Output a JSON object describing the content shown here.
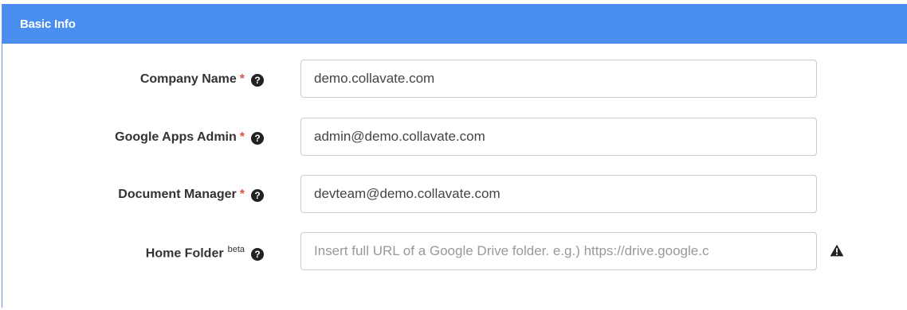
{
  "panel": {
    "title": "Basic Info",
    "header_color": "#4a8ff0"
  },
  "fields": {
    "company_name": {
      "label": "Company Name",
      "required_mark": "*",
      "value": "demo.collavate.com"
    },
    "google_apps_admin": {
      "label": "Google Apps Admin",
      "required_mark": "*",
      "value": "admin@demo.collavate.com"
    },
    "document_manager": {
      "label": "Document Manager",
      "required_mark": "*",
      "value": "devteam@demo.collavate.com"
    },
    "home_folder": {
      "label": "Home Folder",
      "tag": "beta",
      "value": "",
      "placeholder": "Insert full URL of a Google Drive folder. e.g.) https://drive.google.c"
    }
  },
  "icons": {
    "help": "question-circle-icon",
    "warning": "warning-triangle-icon",
    "help_glyph": "?"
  }
}
